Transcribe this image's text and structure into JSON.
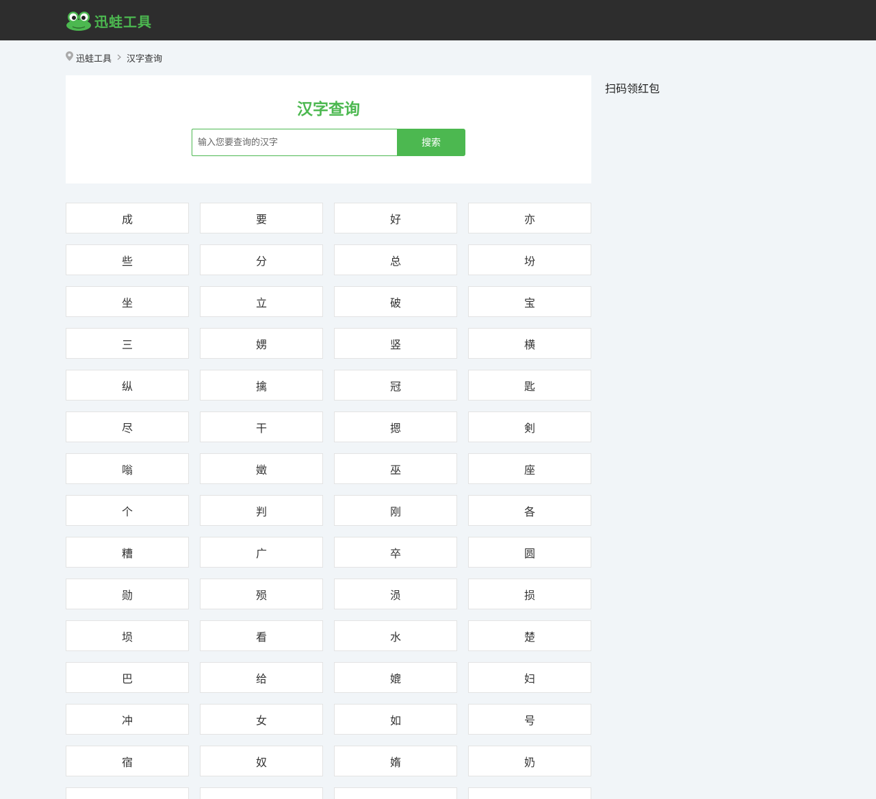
{
  "header": {
    "logo_text": "迅蛙工具",
    "brand_color": "#4cb850",
    "bar_color": "#2d2d2d"
  },
  "breadcrumb": {
    "icon": "location-pin-icon",
    "home": "迅蛙工具",
    "separator_icon": "chevron-right-icon",
    "current": "汉字查询"
  },
  "search": {
    "title": "汉字查询",
    "placeholder": "输入您要查询的汉字",
    "value": "",
    "button_label": "搜索"
  },
  "sidebar": {
    "title": "扫码领红包"
  },
  "characters": [
    "成",
    "要",
    "好",
    "亦",
    "些",
    "分",
    "总",
    "坋",
    "坐",
    "立",
    "破",
    "宝",
    "三",
    "娚",
    "竖",
    "横",
    "纵",
    "擒",
    "冠",
    "匙",
    "尽",
    "干",
    "摁",
    "剣",
    "嗡",
    "嬍",
    "巫",
    "座",
    "个",
    "判",
    "刚",
    "各",
    "糟",
    "广",
    "卒",
    "圆",
    "勋",
    "殒",
    "涢",
    "损",
    "埙",
    "看",
    "水",
    "楚",
    "巴",
    "给",
    "媲",
    "妇",
    "冲",
    "女",
    "如",
    "号",
    "宿",
    "奴",
    "媠",
    "奶",
    "",
    "",
    "",
    ""
  ]
}
